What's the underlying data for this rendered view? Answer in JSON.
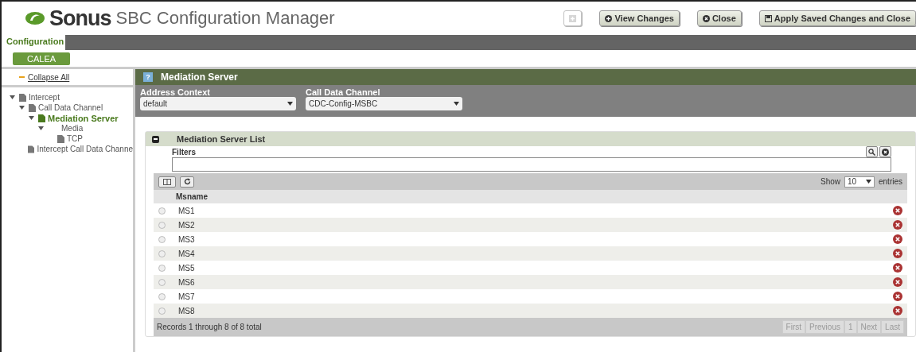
{
  "header": {
    "brand": "Sonus",
    "title": "SBC Configuration Manager",
    "buttons": [
      {
        "kind": "plus",
        "disabled": true
      },
      {
        "kind": "view",
        "label": "View Changes",
        "disabled": false
      },
      {
        "kind": "close",
        "label": "Close",
        "disabled": false
      },
      {
        "kind": "save",
        "label": "Apply Saved Changes and Close",
        "disabled": false
      }
    ]
  },
  "tabs": [
    {
      "label": "Configuration",
      "selected": true
    }
  ],
  "subtabs": [
    {
      "label": "CALEA",
      "selected": true
    }
  ],
  "sidebar": {
    "collapse_all": "Collapse All",
    "tree": [
      {
        "label": "Intercept",
        "kind": "document",
        "expanded": true,
        "selected": false,
        "children": [
          {
            "label": "Call Data Channel",
            "kind": "document",
            "expanded": true,
            "selected": false,
            "children": [
              {
                "label": "Mediation Server",
                "kind": "document",
                "expanded": true,
                "selected": true,
                "children": [
                  {
                    "label": "Media",
                    "kind": "plain",
                    "expanded": true,
                    "selected": false,
                    "children": [
                      {
                        "label": "TCP",
                        "kind": "document",
                        "selected": false
                      }
                    ]
                  }
                ]
              }
            ]
          },
          {
            "label": "Intercept Call Data Channe",
            "kind": "document",
            "selected": false
          }
        ]
      }
    ]
  },
  "panel": {
    "help": "?",
    "title": "Mediation Server",
    "selectors": [
      {
        "label": "Address Context",
        "value": "default"
      },
      {
        "label": "Call Data Channel",
        "value": "CDC-Config-MSBC"
      }
    ],
    "list": {
      "title": "Mediation Server List",
      "filters_label": "Filters",
      "show": "Show",
      "page_size": "10",
      "entries": "entries",
      "column": "Msname",
      "rows": [
        {
          "name": "MS1",
          "selected": false
        },
        {
          "name": "MS2",
          "selected": false
        },
        {
          "name": "MS3",
          "selected": false
        },
        {
          "name": "MS4",
          "selected": false
        },
        {
          "name": "MS5",
          "selected": false
        },
        {
          "name": "MS6",
          "selected": false
        },
        {
          "name": "MS7",
          "selected": false
        },
        {
          "name": "MS8",
          "selected": false
        }
      ],
      "records": "Records 1 through 8 of 8 total",
      "pager": [
        {
          "label": "First",
          "disabled": true
        },
        {
          "label": "Previous",
          "disabled": true
        },
        {
          "label": "1",
          "disabled": true
        },
        {
          "label": "Next",
          "disabled": true
        },
        {
          "label": "Last",
          "disabled": true
        }
      ]
    }
  }
}
